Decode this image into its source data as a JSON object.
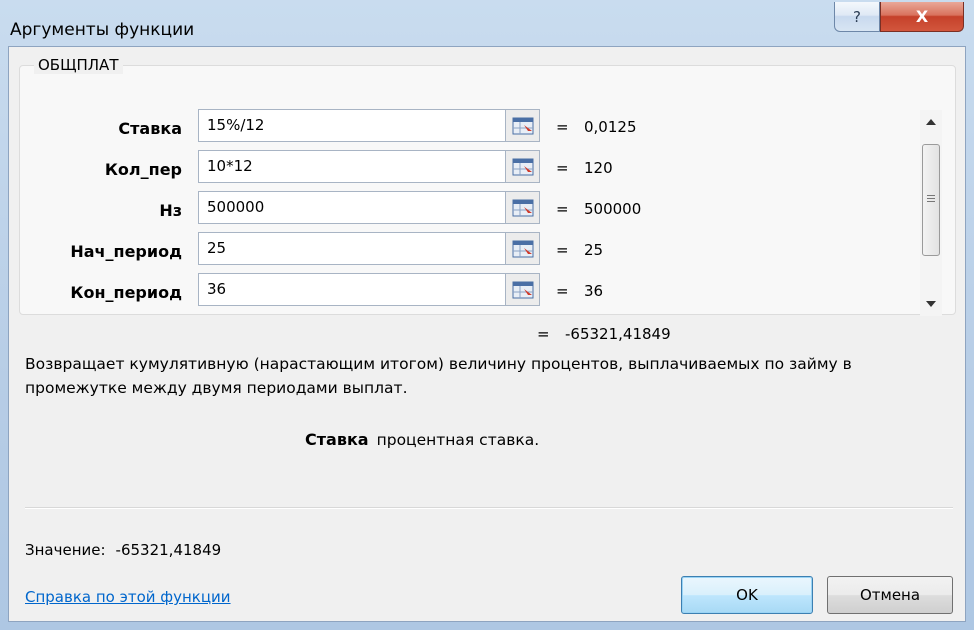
{
  "window": {
    "title": "Аргументы функции"
  },
  "group": {
    "title": "ОБЩПЛАТ"
  },
  "args": [
    {
      "label": "Ставка",
      "value": "15%/12",
      "result": "0,0125"
    },
    {
      "label": "Кол_пер",
      "value": "10*12",
      "result": "120"
    },
    {
      "label": "Нз",
      "value": "500000",
      "result": "500000"
    },
    {
      "label": "Нач_период",
      "value": "25",
      "result": "25"
    },
    {
      "label": "Кон_период",
      "value": "36",
      "result": "36"
    }
  ],
  "equals": "=",
  "formula_result": "-65321,41849",
  "description": "Возвращает кумулятивную (нарастающим итогом) величину процентов, выплачиваемых по займу в промежутке между двумя периодами выплат.",
  "arg_help": {
    "name": "Ставка",
    "text": "процентная ставка."
  },
  "value_line": {
    "label": "Значение:",
    "value": "-65321,41849"
  },
  "help_link": "Справка по этой функции",
  "buttons": {
    "ok": "OK",
    "cancel": "Отмена"
  },
  "title_buttons": {
    "help": "?",
    "close": "X"
  },
  "colors": {
    "link": "#0066cc",
    "close_button": "#c5412a",
    "title_bar": "#b7cde6"
  }
}
